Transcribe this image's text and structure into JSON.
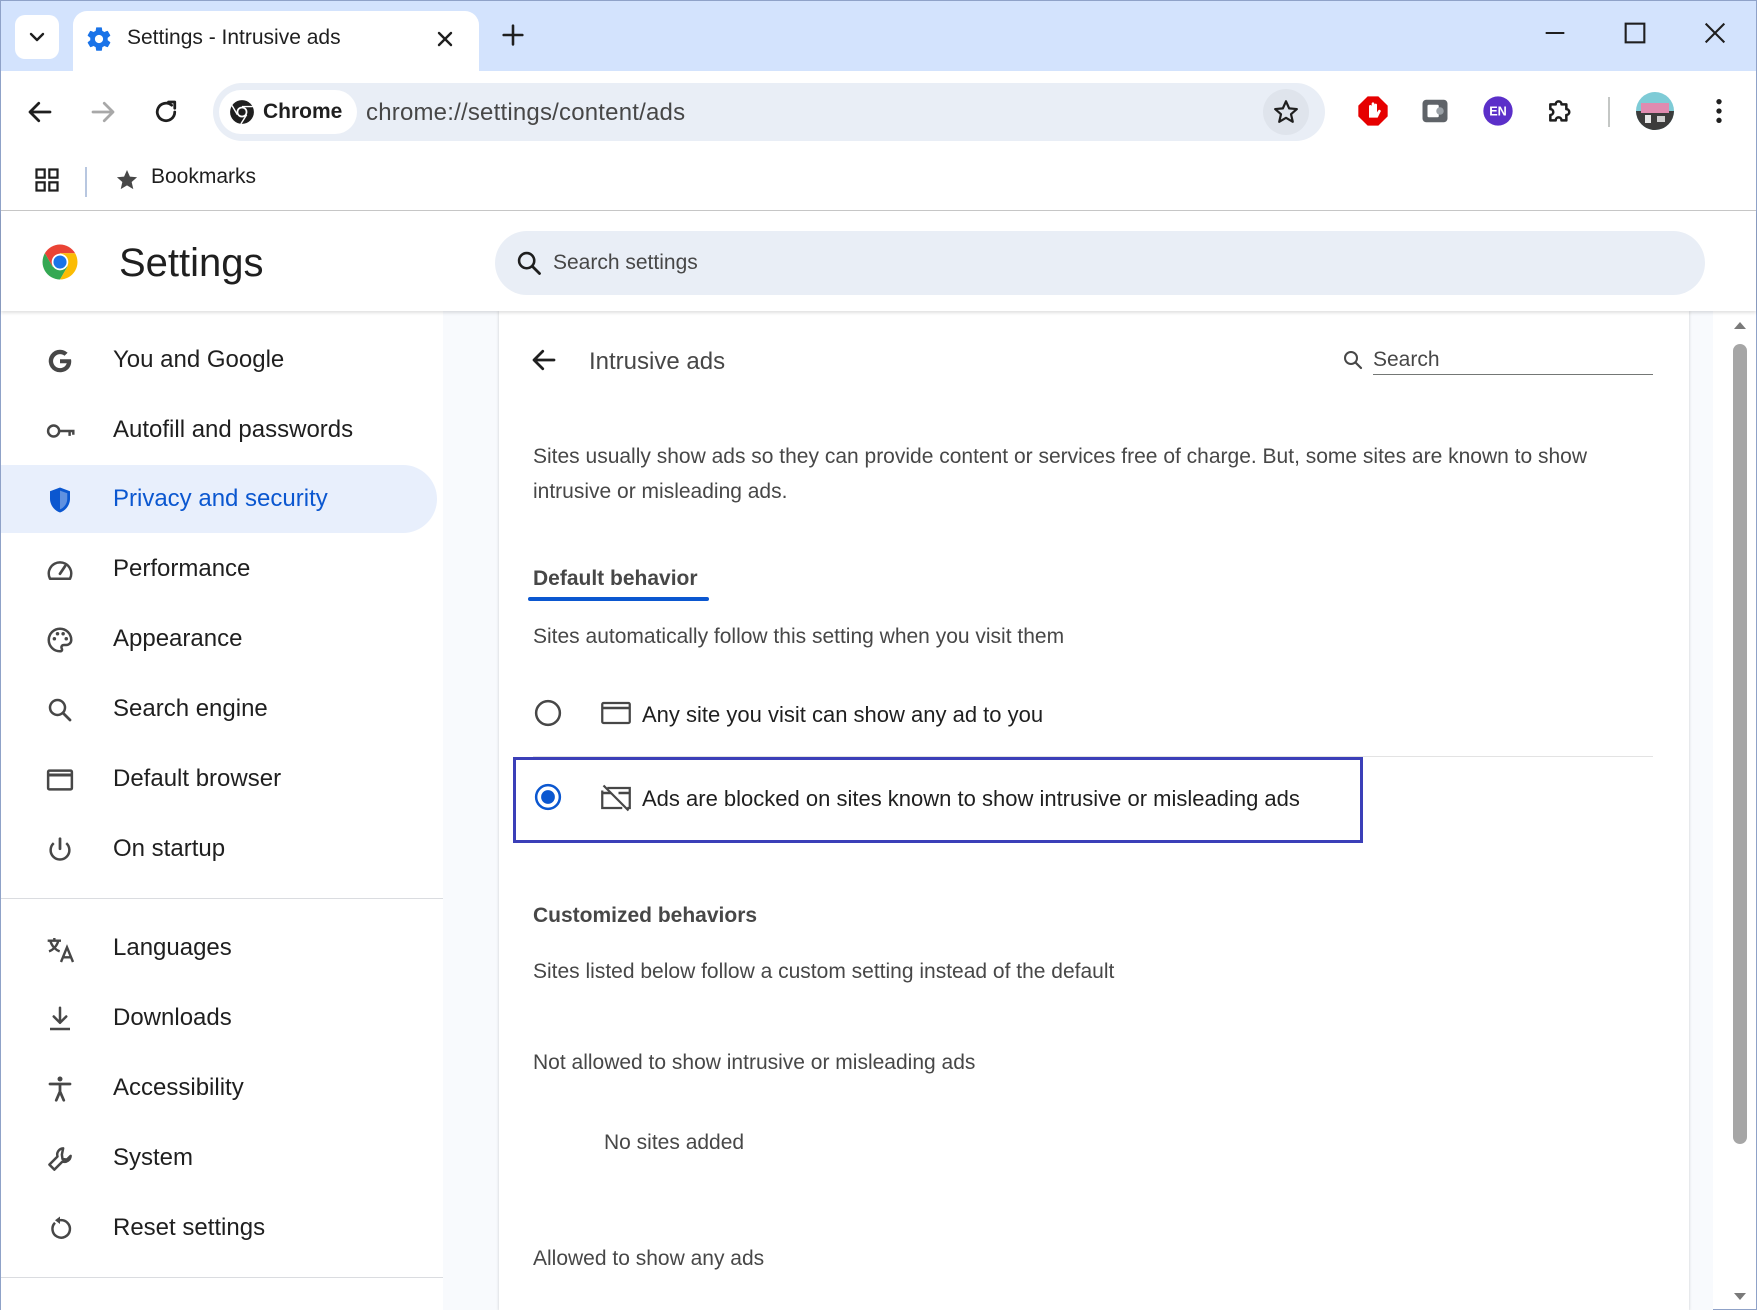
{
  "window": {
    "tab_title": "Settings - Intrusive ads",
    "controls": [
      "minimize-icon",
      "maximize-icon",
      "close-icon"
    ]
  },
  "toolbar": {
    "chip_label": "Chrome",
    "url": "chrome://settings/content/ads",
    "extensions": [
      "adblock-icon",
      "puzzle-photo-icon",
      "en-badge-icon",
      "extensions-icon"
    ],
    "en_badge": "EN"
  },
  "bookmarks": {
    "label": "Bookmarks"
  },
  "header": {
    "title": "Settings",
    "search_placeholder": "Search settings"
  },
  "sidebar": {
    "items": [
      {
        "label": "You and Google",
        "icon": "google-g-icon"
      },
      {
        "label": "Autofill and passwords",
        "icon": "key-icon"
      },
      {
        "label": "Privacy and security",
        "icon": "shield-icon",
        "active": true
      },
      {
        "label": "Performance",
        "icon": "speedometer-icon"
      },
      {
        "label": "Appearance",
        "icon": "palette-icon"
      },
      {
        "label": "Search engine",
        "icon": "search-icon"
      },
      {
        "label": "Default browser",
        "icon": "browser-window-icon"
      },
      {
        "label": "On startup",
        "icon": "power-icon"
      },
      {
        "label": "Languages",
        "icon": "translate-icon"
      },
      {
        "label": "Downloads",
        "icon": "download-icon"
      },
      {
        "label": "Accessibility",
        "icon": "accessibility-icon"
      },
      {
        "label": "System",
        "icon": "wrench-icon"
      },
      {
        "label": "Reset settings",
        "icon": "reset-icon"
      }
    ]
  },
  "page": {
    "title": "Intrusive ads",
    "search_placeholder": "Search",
    "description": "Sites usually show ads so they can provide content or services free of charge. But, some sites are known to show intrusive or misleading ads.",
    "default_tab": "Default behavior",
    "default_sub": "Sites automatically follow this setting when you visit them",
    "options": [
      {
        "label": "Any site you visit can show any ad to you",
        "selected": false,
        "icon": "ad-window-icon"
      },
      {
        "label": "Ads are blocked on sites known to show intrusive or misleading ads",
        "selected": true,
        "icon": "ad-blocked-icon"
      }
    ],
    "custom_head": "Customized behaviors",
    "custom_sub": "Sites listed below follow a custom setting instead of the default",
    "not_allowed_head": "Not allowed to show intrusive or misleading ads",
    "no_sites": "No sites added",
    "allowed_head": "Allowed to show any ads"
  },
  "colors": {
    "accent": "#0b57d0",
    "tabstrip": "#d3e3fd",
    "highlight_box": "#3b3fb8"
  }
}
